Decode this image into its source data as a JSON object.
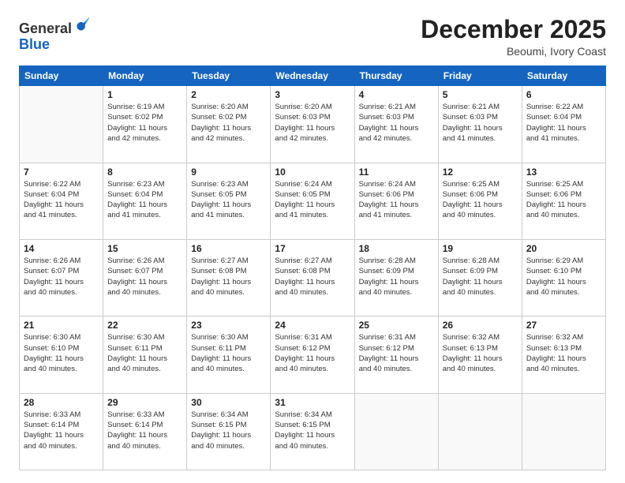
{
  "header": {
    "logo_general": "General",
    "logo_blue": "Blue",
    "month_title": "December 2025",
    "location": "Beoumi, Ivory Coast"
  },
  "days_of_week": [
    "Sunday",
    "Monday",
    "Tuesday",
    "Wednesday",
    "Thursday",
    "Friday",
    "Saturday"
  ],
  "weeks": [
    [
      {
        "day": "",
        "info": ""
      },
      {
        "day": "1",
        "info": "Sunrise: 6:19 AM\nSunset: 6:02 PM\nDaylight: 11 hours\nand 42 minutes."
      },
      {
        "day": "2",
        "info": "Sunrise: 6:20 AM\nSunset: 6:02 PM\nDaylight: 11 hours\nand 42 minutes."
      },
      {
        "day": "3",
        "info": "Sunrise: 6:20 AM\nSunset: 6:03 PM\nDaylight: 11 hours\nand 42 minutes."
      },
      {
        "day": "4",
        "info": "Sunrise: 6:21 AM\nSunset: 6:03 PM\nDaylight: 11 hours\nand 42 minutes."
      },
      {
        "day": "5",
        "info": "Sunrise: 6:21 AM\nSunset: 6:03 PM\nDaylight: 11 hours\nand 41 minutes."
      },
      {
        "day": "6",
        "info": "Sunrise: 6:22 AM\nSunset: 6:04 PM\nDaylight: 11 hours\nand 41 minutes."
      }
    ],
    [
      {
        "day": "7",
        "info": "Sunrise: 6:22 AM\nSunset: 6:04 PM\nDaylight: 11 hours\nand 41 minutes."
      },
      {
        "day": "8",
        "info": "Sunrise: 6:23 AM\nSunset: 6:04 PM\nDaylight: 11 hours\nand 41 minutes."
      },
      {
        "day": "9",
        "info": "Sunrise: 6:23 AM\nSunset: 6:05 PM\nDaylight: 11 hours\nand 41 minutes."
      },
      {
        "day": "10",
        "info": "Sunrise: 6:24 AM\nSunset: 6:05 PM\nDaylight: 11 hours\nand 41 minutes."
      },
      {
        "day": "11",
        "info": "Sunrise: 6:24 AM\nSunset: 6:06 PM\nDaylight: 11 hours\nand 41 minutes."
      },
      {
        "day": "12",
        "info": "Sunrise: 6:25 AM\nSunset: 6:06 PM\nDaylight: 11 hours\nand 40 minutes."
      },
      {
        "day": "13",
        "info": "Sunrise: 6:25 AM\nSunset: 6:06 PM\nDaylight: 11 hours\nand 40 minutes."
      }
    ],
    [
      {
        "day": "14",
        "info": "Sunrise: 6:26 AM\nSunset: 6:07 PM\nDaylight: 11 hours\nand 40 minutes."
      },
      {
        "day": "15",
        "info": "Sunrise: 6:26 AM\nSunset: 6:07 PM\nDaylight: 11 hours\nand 40 minutes."
      },
      {
        "day": "16",
        "info": "Sunrise: 6:27 AM\nSunset: 6:08 PM\nDaylight: 11 hours\nand 40 minutes."
      },
      {
        "day": "17",
        "info": "Sunrise: 6:27 AM\nSunset: 6:08 PM\nDaylight: 11 hours\nand 40 minutes."
      },
      {
        "day": "18",
        "info": "Sunrise: 6:28 AM\nSunset: 6:09 PM\nDaylight: 11 hours\nand 40 minutes."
      },
      {
        "day": "19",
        "info": "Sunrise: 6:28 AM\nSunset: 6:09 PM\nDaylight: 11 hours\nand 40 minutes."
      },
      {
        "day": "20",
        "info": "Sunrise: 6:29 AM\nSunset: 6:10 PM\nDaylight: 11 hours\nand 40 minutes."
      }
    ],
    [
      {
        "day": "21",
        "info": "Sunrise: 6:30 AM\nSunset: 6:10 PM\nDaylight: 11 hours\nand 40 minutes."
      },
      {
        "day": "22",
        "info": "Sunrise: 6:30 AM\nSunset: 6:11 PM\nDaylight: 11 hours\nand 40 minutes."
      },
      {
        "day": "23",
        "info": "Sunrise: 6:30 AM\nSunset: 6:11 PM\nDaylight: 11 hours\nand 40 minutes."
      },
      {
        "day": "24",
        "info": "Sunrise: 6:31 AM\nSunset: 6:12 PM\nDaylight: 11 hours\nand 40 minutes."
      },
      {
        "day": "25",
        "info": "Sunrise: 6:31 AM\nSunset: 6:12 PM\nDaylight: 11 hours\nand 40 minutes."
      },
      {
        "day": "26",
        "info": "Sunrise: 6:32 AM\nSunset: 6:13 PM\nDaylight: 11 hours\nand 40 minutes."
      },
      {
        "day": "27",
        "info": "Sunrise: 6:32 AM\nSunset: 6:13 PM\nDaylight: 11 hours\nand 40 minutes."
      }
    ],
    [
      {
        "day": "28",
        "info": "Sunrise: 6:33 AM\nSunset: 6:14 PM\nDaylight: 11 hours\nand 40 minutes."
      },
      {
        "day": "29",
        "info": "Sunrise: 6:33 AM\nSunset: 6:14 PM\nDaylight: 11 hours\nand 40 minutes."
      },
      {
        "day": "30",
        "info": "Sunrise: 6:34 AM\nSunset: 6:15 PM\nDaylight: 11 hours\nand 40 minutes."
      },
      {
        "day": "31",
        "info": "Sunrise: 6:34 AM\nSunset: 6:15 PM\nDaylight: 11 hours\nand 40 minutes."
      },
      {
        "day": "",
        "info": ""
      },
      {
        "day": "",
        "info": ""
      },
      {
        "day": "",
        "info": ""
      }
    ]
  ]
}
